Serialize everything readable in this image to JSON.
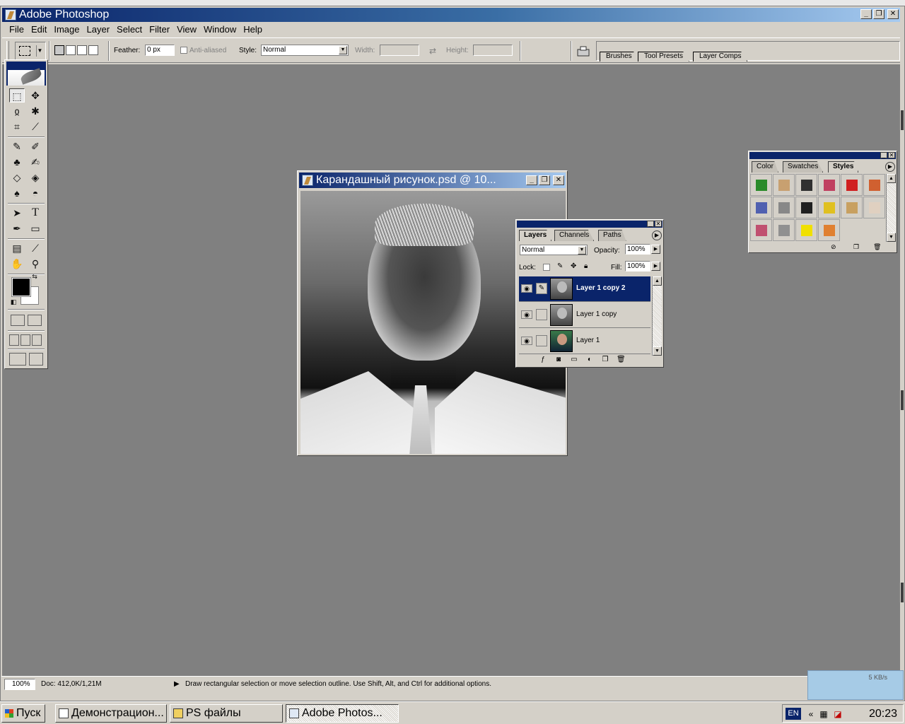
{
  "app": {
    "title": "Adobe Photoshop",
    "menu": [
      "File",
      "Edit",
      "Image",
      "Layer",
      "Select",
      "Filter",
      "View",
      "Window",
      "Help"
    ]
  },
  "options": {
    "feather_label": "Feather:",
    "feather_value": "0 px",
    "anti_aliased_label": "Anti-aliased",
    "style_label": "Style:",
    "style_value": "Normal",
    "width_label": "Width:",
    "height_label": "Height:",
    "well_tabs": [
      "Brushes",
      "Tool Presets",
      "Layer Comps"
    ]
  },
  "document": {
    "title": "Карандашный рисунок.psd @ 10..."
  },
  "layers_palette": {
    "tabs": [
      "Layers",
      "Channels",
      "Paths"
    ],
    "blend_mode": "Normal",
    "opacity_label": "Opacity:",
    "opacity_value": "100%",
    "lock_label": "Lock:",
    "fill_label": "Fill:",
    "fill_value": "100%",
    "layers": [
      {
        "name": "Layer 1 copy 2",
        "selected": true
      },
      {
        "name": "Layer 1 copy",
        "selected": false
      },
      {
        "name": "Layer 1",
        "selected": false
      }
    ]
  },
  "styles_palette": {
    "tabs": [
      "Color",
      "Swatches",
      "Styles"
    ],
    "swatch_colors": [
      "#2a8a2a",
      "#c8a070",
      "#303030",
      "#c04060",
      "#d02020",
      "#d06030",
      "#5060b0",
      "#888888",
      "#202020",
      "#e0c020",
      "#c8a060",
      "#e0d0c0",
      "#c05070",
      "#909090",
      "#f0e000",
      "#e08030"
    ]
  },
  "statusbar": {
    "zoom": "100%",
    "doc": "Doc: 412,0K/1,21M",
    "hint": "Draw rectangular selection or move selection outline.  Use Shift, Alt, and Ctrl for additional options."
  },
  "netmeter": {
    "rate": "5 KB/s"
  },
  "taskbar": {
    "start": "Пуск",
    "tasks": [
      "Демонстрацион...",
      "PS файлы",
      "Adobe Photos..."
    ],
    "lang": "EN",
    "clock": "20:23"
  }
}
